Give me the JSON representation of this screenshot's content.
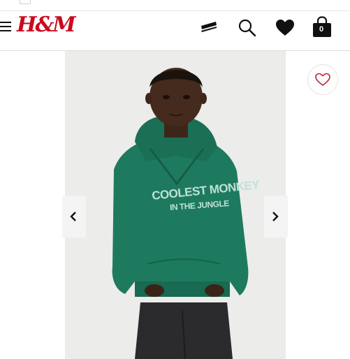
{
  "brand": {
    "logo_text": "H&M",
    "color": "#cc071e"
  },
  "header": {
    "icons": [
      "menu-icon",
      "chat-bubble-icon",
      "search-icon",
      "heart-icon",
      "bag-icon"
    ],
    "bag_count": "0"
  },
  "product": {
    "image_alt": "Child wearing green hoodie",
    "hoodie_text_line1": "COOLEST MONKEY",
    "hoodie_text_line2": "IN THE JUNGLE",
    "hoodie_color": "#1e7a5e",
    "background_color": "#ececea"
  },
  "gallery": {
    "prev_icon": "chevron-left-icon",
    "next_icon": "chevron-right-icon"
  }
}
